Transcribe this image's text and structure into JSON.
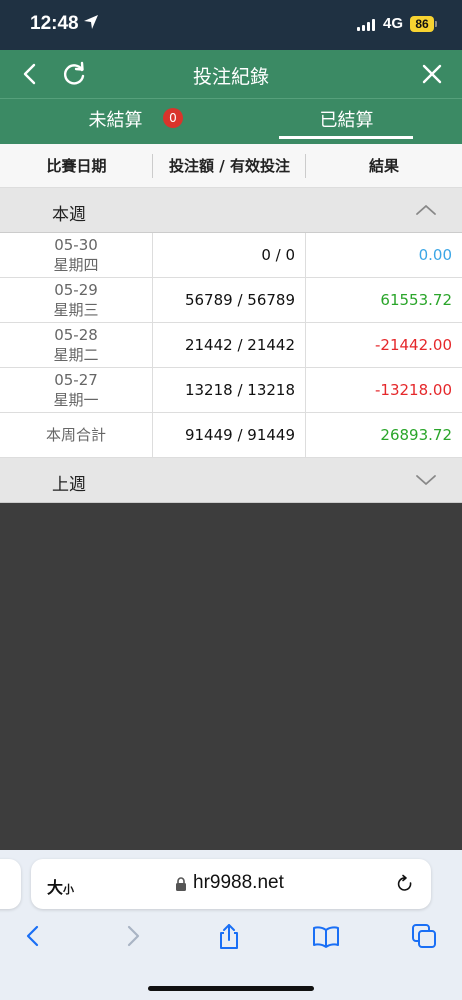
{
  "status_bar": {
    "time": "12:48",
    "network": "4G",
    "battery": "86"
  },
  "header": {
    "title": "投注紀錄"
  },
  "tabs": [
    {
      "label": "未結算",
      "badge": "0",
      "active": false
    },
    {
      "label": "已結算",
      "active": true
    }
  ],
  "table": {
    "columns": [
      "比賽日期",
      "投注額 / 有效投注",
      "結果"
    ],
    "sections": [
      {
        "label": "本週",
        "expanded": true,
        "rows": [
          {
            "date": "05-30",
            "weekday": "星期四",
            "amount": "0 / 0",
            "result": "0.00",
            "result_type": "zero"
          },
          {
            "date": "05-29",
            "weekday": "星期三",
            "amount": "56789 / 56789",
            "result": "61553.72",
            "result_type": "positive"
          },
          {
            "date": "05-28",
            "weekday": "星期二",
            "amount": "21442 / 21442",
            "result": "-21442.00",
            "result_type": "negative"
          },
          {
            "date": "05-27",
            "weekday": "星期一",
            "amount": "13218 / 13218",
            "result": "-13218.00",
            "result_type": "negative"
          }
        ],
        "total": {
          "label": "本周合計",
          "amount": "91449 / 91449",
          "result": "26893.72"
        }
      },
      {
        "label": "上週",
        "expanded": false
      }
    ]
  },
  "browser": {
    "text_size_big": "大",
    "text_size_small": "小",
    "url": "hr9988.net"
  },
  "colors": {
    "header_green": "#3b8a64",
    "status_bar": "#1f3142",
    "positive": "#2aa52a",
    "negative": "#e5282b",
    "zero": "#3ba6e6",
    "badge": "#d9342b"
  }
}
